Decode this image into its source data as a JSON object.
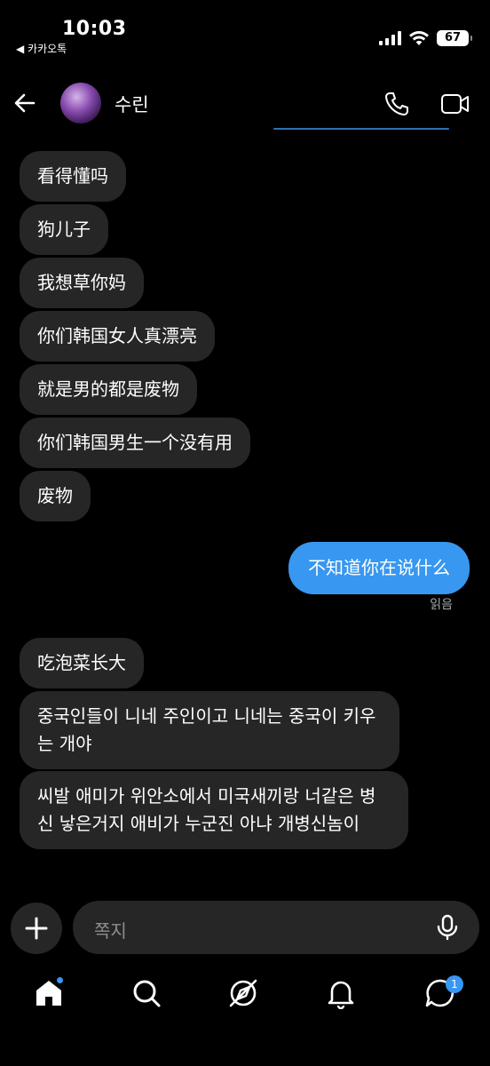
{
  "status_bar": {
    "time": "10:03",
    "back_app": "◀ 카카오톡",
    "battery": "67"
  },
  "header": {
    "contact_name": "수린"
  },
  "messages": [
    {
      "side": "incoming",
      "text": "看得懂吗"
    },
    {
      "side": "incoming",
      "text": "狗儿子"
    },
    {
      "side": "incoming",
      "text": "我想草你妈"
    },
    {
      "side": "incoming",
      "text": "你们韩国女人真漂亮"
    },
    {
      "side": "incoming",
      "text": "就是男的都是废物"
    },
    {
      "side": "incoming",
      "text": "你们韩国男生一个没有用"
    },
    {
      "side": "incoming",
      "text": "废物"
    },
    {
      "side": "outgoing",
      "text": "不知道你在说什么"
    },
    {
      "side": "incoming",
      "text": "吃泡菜长大"
    },
    {
      "side": "incoming",
      "text": "중국인들이 니네 주인이고 니네는 중국이 키우는 개야"
    },
    {
      "side": "incoming",
      "text": "씨발 애미가 위안소에서 미국새끼랑 너같은 병신 낳은거지  애비가 누군진 아냐  개병신놈이"
    }
  ],
  "read_receipt": "읽음",
  "composer": {
    "placeholder": "쪽지"
  },
  "tab_bar": {
    "messages_badge": "1"
  },
  "colors": {
    "accent": "#3897f0",
    "incoming_bubble": "#262626",
    "background": "#000000"
  }
}
